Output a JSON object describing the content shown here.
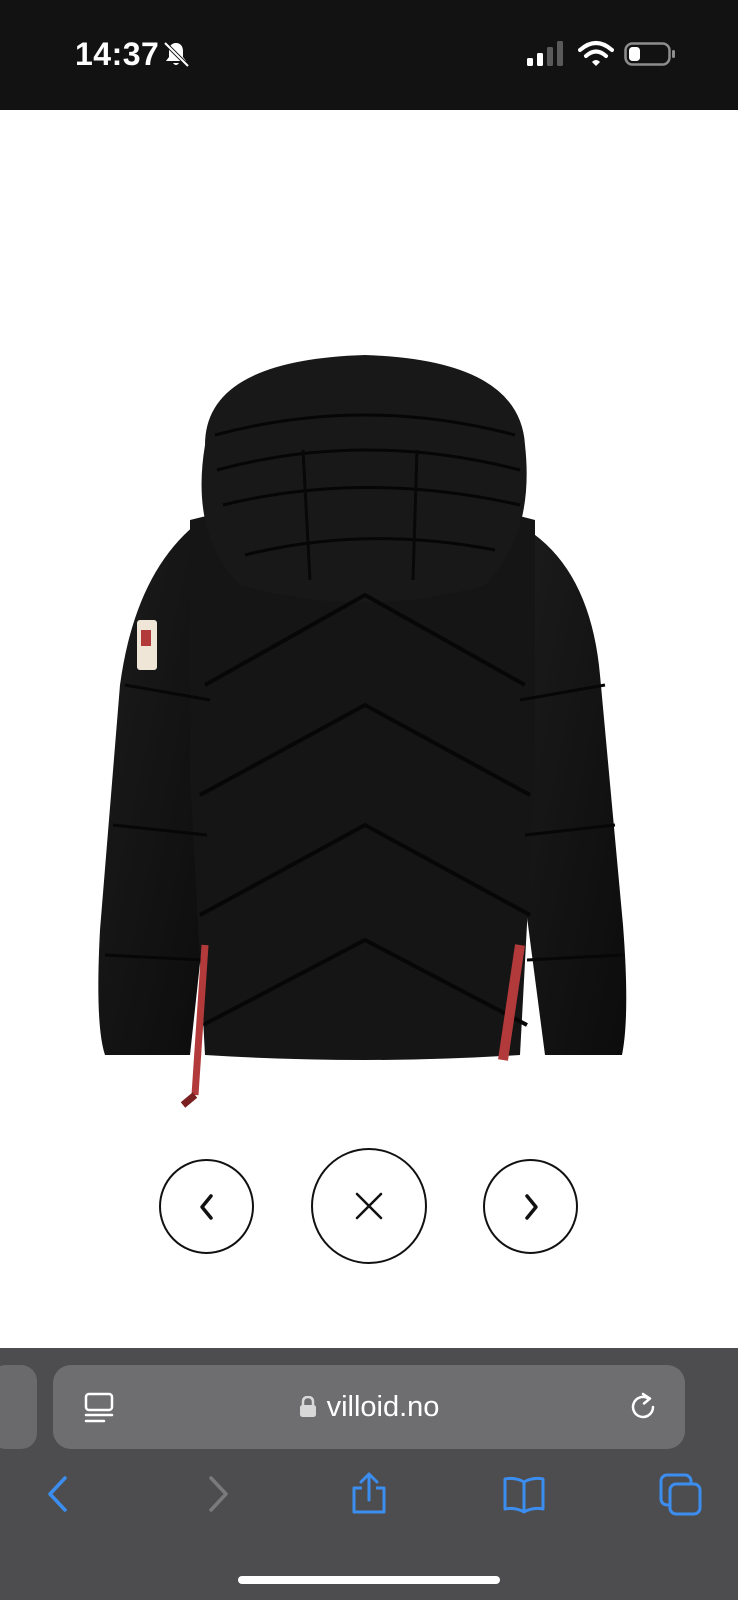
{
  "status_bar": {
    "time": "14:37",
    "icons": [
      "bell-slash-icon",
      "cellular-signal-icon",
      "wifi-icon",
      "battery-icon"
    ]
  },
  "viewer": {
    "image_alt": "Black hooded down jacket, back view",
    "controls": [
      {
        "name": "previous",
        "icon": "chevron-left-icon"
      },
      {
        "name": "close",
        "icon": "close-icon"
      },
      {
        "name": "next",
        "icon": "chevron-right-icon"
      }
    ]
  },
  "browser": {
    "url": "villoid.no",
    "toolbar": [
      "back-icon",
      "forward-icon",
      "share-icon",
      "bookmarks-icon",
      "tabs-icon"
    ]
  },
  "colors": {
    "status_bar_bg": "#121212",
    "jacket": "#141414",
    "accent_red": "#b33a3a",
    "browser_chrome": "#4d4d4f",
    "toolbar_blue": "#3b8ef0"
  }
}
